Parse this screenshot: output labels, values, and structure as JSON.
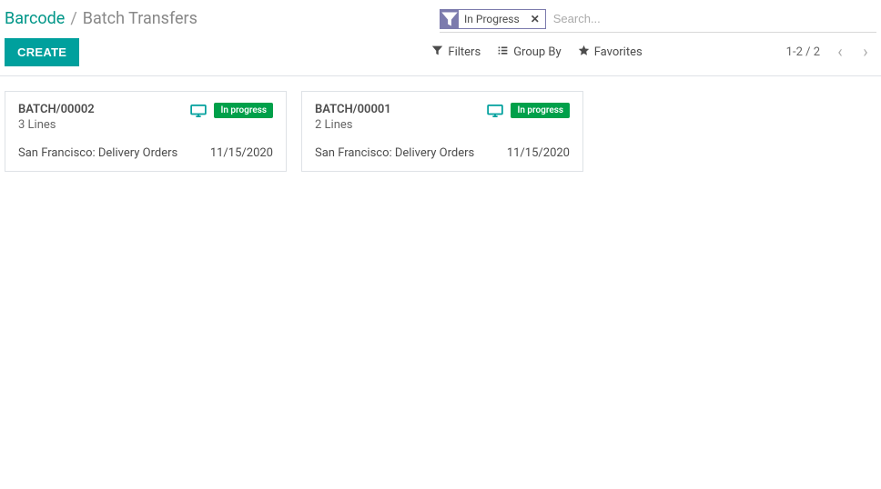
{
  "breadcrumb": {
    "parent": "Barcode",
    "separator": "/",
    "current": "Batch Transfers"
  },
  "search": {
    "facet_label": "In Progress",
    "placeholder": "Search..."
  },
  "toolbar": {
    "create_label": "CREATE",
    "filters_label": "Filters",
    "groupby_label": "Group By",
    "favorites_label": "Favorites",
    "paging": "1-2 / 2"
  },
  "cards": [
    {
      "title": "BATCH/00002",
      "subtitle": "3 Lines",
      "badge": "In progress",
      "location": "San Francisco: Delivery Orders",
      "date": "11/15/2020"
    },
    {
      "title": "BATCH/00001",
      "subtitle": "2 Lines",
      "badge": "In progress",
      "location": "San Francisco: Delivery Orders",
      "date": "11/15/2020"
    }
  ]
}
